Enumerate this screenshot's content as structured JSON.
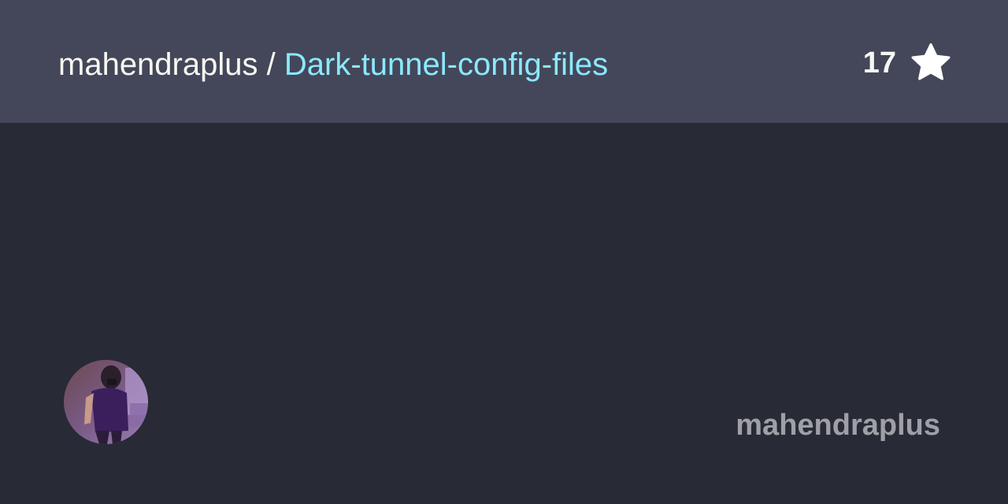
{
  "header": {
    "owner": "mahendraplus",
    "separator": "/",
    "repo_name": "Dark-tunnel-config-files"
  },
  "stars": {
    "count": "17",
    "icon": "star-icon"
  },
  "footer": {
    "avatar_icon": "avatar",
    "username": "mahendraplus"
  },
  "colors": {
    "header_bg": "#44475a",
    "body_bg": "#282a36",
    "repo_name": "#8be9fd",
    "text": "#f8f8f2",
    "username": "#9ea0a6"
  }
}
